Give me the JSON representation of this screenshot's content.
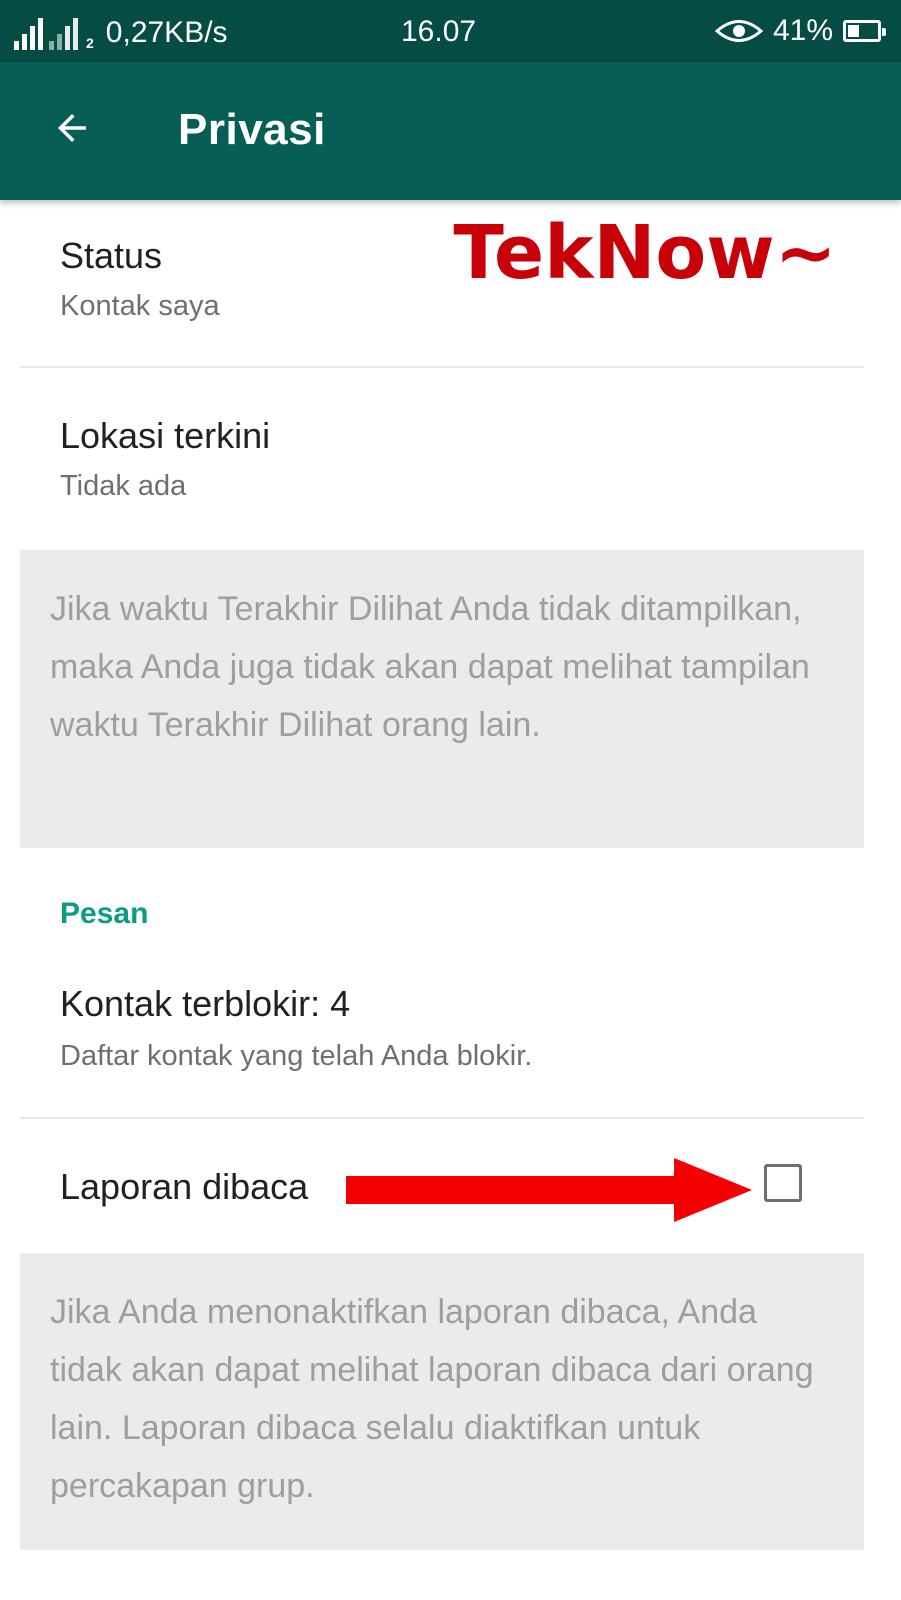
{
  "status_bar": {
    "sim2_label": "2",
    "network_speed": "0,27KB/s",
    "time": "16.07",
    "battery_percent_label": "41%",
    "battery_level": 0.41
  },
  "app_bar": {
    "title": "Privasi"
  },
  "items": {
    "status": {
      "title": "Status",
      "subtitle": "Kontak saya"
    },
    "location": {
      "title": "Lokasi terkini",
      "subtitle": "Tidak ada"
    },
    "blocked": {
      "title": "Kontak terblokir: 4",
      "subtitle": "Daftar kontak yang telah Anda blokir."
    },
    "read_receipts": {
      "title": "Laporan dibaca",
      "checked": false
    }
  },
  "info": {
    "last_seen": "Jika waktu Terakhir Dilihat Anda tidak ditampilkan, maka Anda juga tidak akan dapat melihat tampilan waktu Terakhir Dilihat orang lain.",
    "read_receipts": "Jika Anda menonaktifkan laporan dibaca, Anda tidak akan dapat melihat laporan dibaca dari orang lain. Laporan dibaca selalu diaktifkan untuk percakapan grup."
  },
  "sections": {
    "messages": "Pesan"
  },
  "watermark": {
    "text": "TekNow~"
  },
  "colors": {
    "status_bar": "#054d44",
    "app_bar": "#075e54",
    "section_accent": "#0b9c84",
    "info_background": "#ebebeb",
    "annotation_arrow": "#f50000",
    "watermark_red": "#c8000a"
  }
}
